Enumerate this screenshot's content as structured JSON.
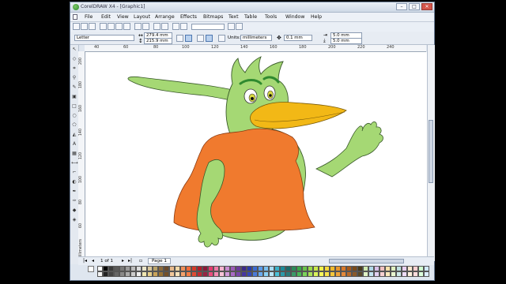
{
  "window": {
    "title": "CorelDRAW X4 - [Graphic1]",
    "minimize": "–",
    "maximize": "□",
    "close": "✕"
  },
  "menu": [
    {
      "label": "File"
    },
    {
      "label": "Edit"
    },
    {
      "label": "View"
    },
    {
      "label": "Layout"
    },
    {
      "label": "Arrange"
    },
    {
      "label": "Effects"
    },
    {
      "label": "Bitmaps"
    },
    {
      "label": "Text"
    },
    {
      "label": "Table"
    },
    {
      "label": "Tools"
    },
    {
      "label": "Window"
    },
    {
      "label": "Help"
    }
  ],
  "property_bar": {
    "paper": "Letter",
    "width": "279.4 mm",
    "height": "215.9 mm",
    "units_label": "Units:",
    "units_value": "millimeters",
    "nudge": "0.1 mm",
    "dup_x": "5.0 mm",
    "dup_y": "5.0 mm"
  },
  "ruler": {
    "h_ticks": [
      "40",
      "60",
      "80",
      "100",
      "120",
      "140",
      "160",
      "180",
      "200",
      "220",
      "240"
    ],
    "v_ticks": [
      "200",
      "180",
      "160",
      "140",
      "120",
      "100",
      "80",
      "60",
      "40"
    ],
    "unit": "millimeters"
  },
  "pager": {
    "page_count": "1 of 1",
    "tab": "Page 1"
  },
  "palette_colors": [
    "#ffffff",
    "#000000",
    "#3a3a3a",
    "#5a5a5a",
    "#7a7a7a",
    "#9a9a9a",
    "#bcbcbc",
    "#dcdcdc",
    "#e9e4c8",
    "#d9c79a",
    "#b9a269",
    "#8c6a3c",
    "#6b4a2a",
    "#e7b98c",
    "#f2d7a6",
    "#ef8f5a",
    "#f26b3a",
    "#d43a2a",
    "#b01e2a",
    "#8b1a3a",
    "#e33b6f",
    "#f07aa8",
    "#f5b3cf",
    "#c98bd0",
    "#9a5bb8",
    "#6b3a9a",
    "#3a2a8a",
    "#2a3aa8",
    "#3a6ad0",
    "#5a9ae8",
    "#7ac0f0",
    "#a8dcf5",
    "#3ab0c8",
    "#1a8a9a",
    "#1a6a6a",
    "#2a8a5a",
    "#3aa84a",
    "#6ac24a",
    "#9ad84a",
    "#c8e84a",
    "#f0f04a",
    "#f5d83a",
    "#f0b82a",
    "#e8962a",
    "#d8782a",
    "#a85a1a",
    "#7a4a1a",
    "#4a3a1a",
    "#cfe9b0",
    "#b0d8e8",
    "#d8c0e8",
    "#f0c0c0",
    "#f8e0a8",
    "#e0f0c0",
    "#c0e0e0",
    "#e8d0f0",
    "#ffe8d0",
    "#ffd0d0",
    "#d0ffd0",
    "#d0e8ff"
  ],
  "palette_colors_row2": [
    "#f5f5f5",
    "#222222",
    "#444444",
    "#666666",
    "#888888",
    "#aaaaaa",
    "#cccccc",
    "#eeeeee",
    "#f0e6b0",
    "#e6cf8a",
    "#c9a35a",
    "#9a7336",
    "#74502a",
    "#f2c79a",
    "#f8e2bb",
    "#f4a06a",
    "#f47c46",
    "#de4b34",
    "#be2b34",
    "#962444",
    "#ea4c7c",
    "#f48ab2",
    "#f8c2d8",
    "#d29adb",
    "#a86ac4",
    "#7846a8",
    "#4636a0",
    "#3648b8",
    "#4a7ad8",
    "#6aaaee",
    "#8ad0f4",
    "#b8e4f8",
    "#4ac0d8",
    "#2a9aaa",
    "#2a7a7a",
    "#3a9a6a",
    "#4ab85a",
    "#7ad25a",
    "#aae25a",
    "#d8f25a",
    "#f8f85a",
    "#f8e24a",
    "#f4c63a",
    "#ee a43a",
    "#e2883a",
    "#b86a2a",
    "#8a5a2a",
    "#5a4a2a",
    "#dff2c4",
    "#c4e4f0",
    "#e2d0f0",
    "#f6d0d0",
    "#fbe9bc",
    "#e9f6d0",
    "#d0eaea",
    "#efdcf6",
    "#fff0dc",
    "#ffdcdc",
    "#dcffdc",
    "#dcecff"
  ]
}
